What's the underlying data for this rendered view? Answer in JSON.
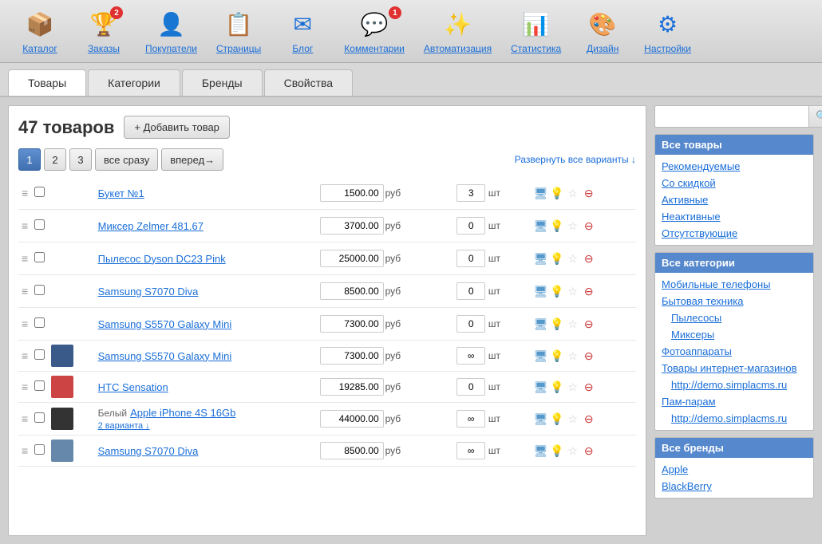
{
  "nav": {
    "items": [
      {
        "id": "catalog",
        "label": "Каталог",
        "icon": "📦",
        "badge": null
      },
      {
        "id": "orders",
        "label": "Заказы",
        "icon": "🏆",
        "badge": "2"
      },
      {
        "id": "customers",
        "label": "Покупатели",
        "icon": "👤",
        "badge": null
      },
      {
        "id": "pages",
        "label": "Страницы",
        "icon": "📋",
        "badge": null
      },
      {
        "id": "blog",
        "label": "Блог",
        "icon": "✉",
        "badge": null
      },
      {
        "id": "comments",
        "label": "Комментарии",
        "icon": "💬",
        "badge": "1"
      },
      {
        "id": "automation",
        "label": "Автоматизация",
        "icon": "✨",
        "badge": null
      },
      {
        "id": "stats",
        "label": "Статистика",
        "icon": "📊",
        "badge": null
      },
      {
        "id": "design",
        "label": "Дизайн",
        "icon": "🎨",
        "badge": null
      },
      {
        "id": "settings",
        "label": "Настройки",
        "icon": "⚙",
        "badge": null
      }
    ]
  },
  "tabs": [
    {
      "id": "goods",
      "label": "Товары",
      "active": true
    },
    {
      "id": "categories",
      "label": "Категории",
      "active": false
    },
    {
      "id": "brands",
      "label": "Бренды",
      "active": false
    },
    {
      "id": "properties",
      "label": "Свойства",
      "active": false
    }
  ],
  "content": {
    "item_count": "47 товаров",
    "add_btn_label": "+ Добавить товар",
    "pagination": {
      "pages": [
        "1",
        "2",
        "3"
      ],
      "all_label": "все сразу",
      "next_label": "вперед→"
    },
    "expand_link": "Развернуть все варианты ↓",
    "products": [
      {
        "id": 1,
        "name": "Букет №1",
        "price": "1500.00",
        "qty": "3",
        "unit": "шт",
        "has_thumb": false,
        "thumb_src": "",
        "color": "",
        "variants": ""
      },
      {
        "id": 2,
        "name": "Миксер Zelmer 481.67",
        "price": "3700.00",
        "qty": "0",
        "unit": "шт",
        "has_thumb": false,
        "thumb_src": "",
        "color": "",
        "variants": ""
      },
      {
        "id": 3,
        "name": "Пылесос Dyson DC23 Pink",
        "price": "25000.00",
        "qty": "0",
        "unit": "шт",
        "has_thumb": false,
        "thumb_src": "",
        "color": "",
        "variants": ""
      },
      {
        "id": 4,
        "name": "Samsung S7070 Diva",
        "price": "8500.00",
        "qty": "0",
        "unit": "шт",
        "has_thumb": false,
        "thumb_src": "",
        "color": "",
        "variants": ""
      },
      {
        "id": 5,
        "name": "Samsung S5570 Galaxy Mini",
        "price": "7300.00",
        "qty": "0",
        "unit": "шт",
        "has_thumb": false,
        "thumb_src": "",
        "color": "",
        "variants": ""
      },
      {
        "id": 6,
        "name": "Samsung S5570 Galaxy Mini",
        "price": "7300.00",
        "qty": "∞",
        "unit": "шт",
        "has_thumb": true,
        "thumb_color": "#3a5a8a",
        "color": "",
        "variants": ""
      },
      {
        "id": 7,
        "name": "HTC Sensation",
        "price": "19285.00",
        "qty": "0",
        "unit": "шт",
        "has_thumb": true,
        "thumb_color": "#cc4444",
        "color": "",
        "variants": ""
      },
      {
        "id": 8,
        "name": "Apple iPhone 4S 16Gb",
        "price": "44000.00",
        "qty": "∞",
        "unit": "шт",
        "has_thumb": true,
        "thumb_color": "#333",
        "color": "Белый",
        "variants": "2 варианта ↓"
      },
      {
        "id": 9,
        "name": "Samsung S7070 Diva",
        "price": "8500.00",
        "qty": "∞",
        "unit": "шт",
        "has_thumb": true,
        "thumb_color": "#6688aa",
        "color": "",
        "variants": ""
      }
    ]
  },
  "sidebar": {
    "search_placeholder": "",
    "search_btn_label": "🔍",
    "filter_header": "Все товары",
    "filters": [
      {
        "label": "Рекомендуемые",
        "indent": false
      },
      {
        "label": "Со скидкой",
        "indent": false
      },
      {
        "label": "Активные",
        "indent": false
      },
      {
        "label": "Неактивные",
        "indent": false
      },
      {
        "label": "Отсутствующие",
        "indent": false
      }
    ],
    "categories_header": "Все категории",
    "categories": [
      {
        "label": "Мобильные телефоны",
        "indent": false
      },
      {
        "label": "Бытовая техника",
        "indent": false
      },
      {
        "label": "Пылесосы",
        "indent": true
      },
      {
        "label": "Миксеры",
        "indent": true
      },
      {
        "label": "Фотоаппараты",
        "indent": false
      },
      {
        "label": "Товары интернет-магазинов",
        "indent": false
      },
      {
        "label": "http://demo.simplacms.ru",
        "indent": true
      },
      {
        "label": "Пам-парам",
        "indent": false
      },
      {
        "label": "http://demo.simplacms.ru",
        "indent": true
      }
    ],
    "brands_header": "Все бренды",
    "brands": [
      {
        "label": "Apple",
        "indent": false
      },
      {
        "label": "BlackBerry",
        "indent": false
      }
    ]
  }
}
